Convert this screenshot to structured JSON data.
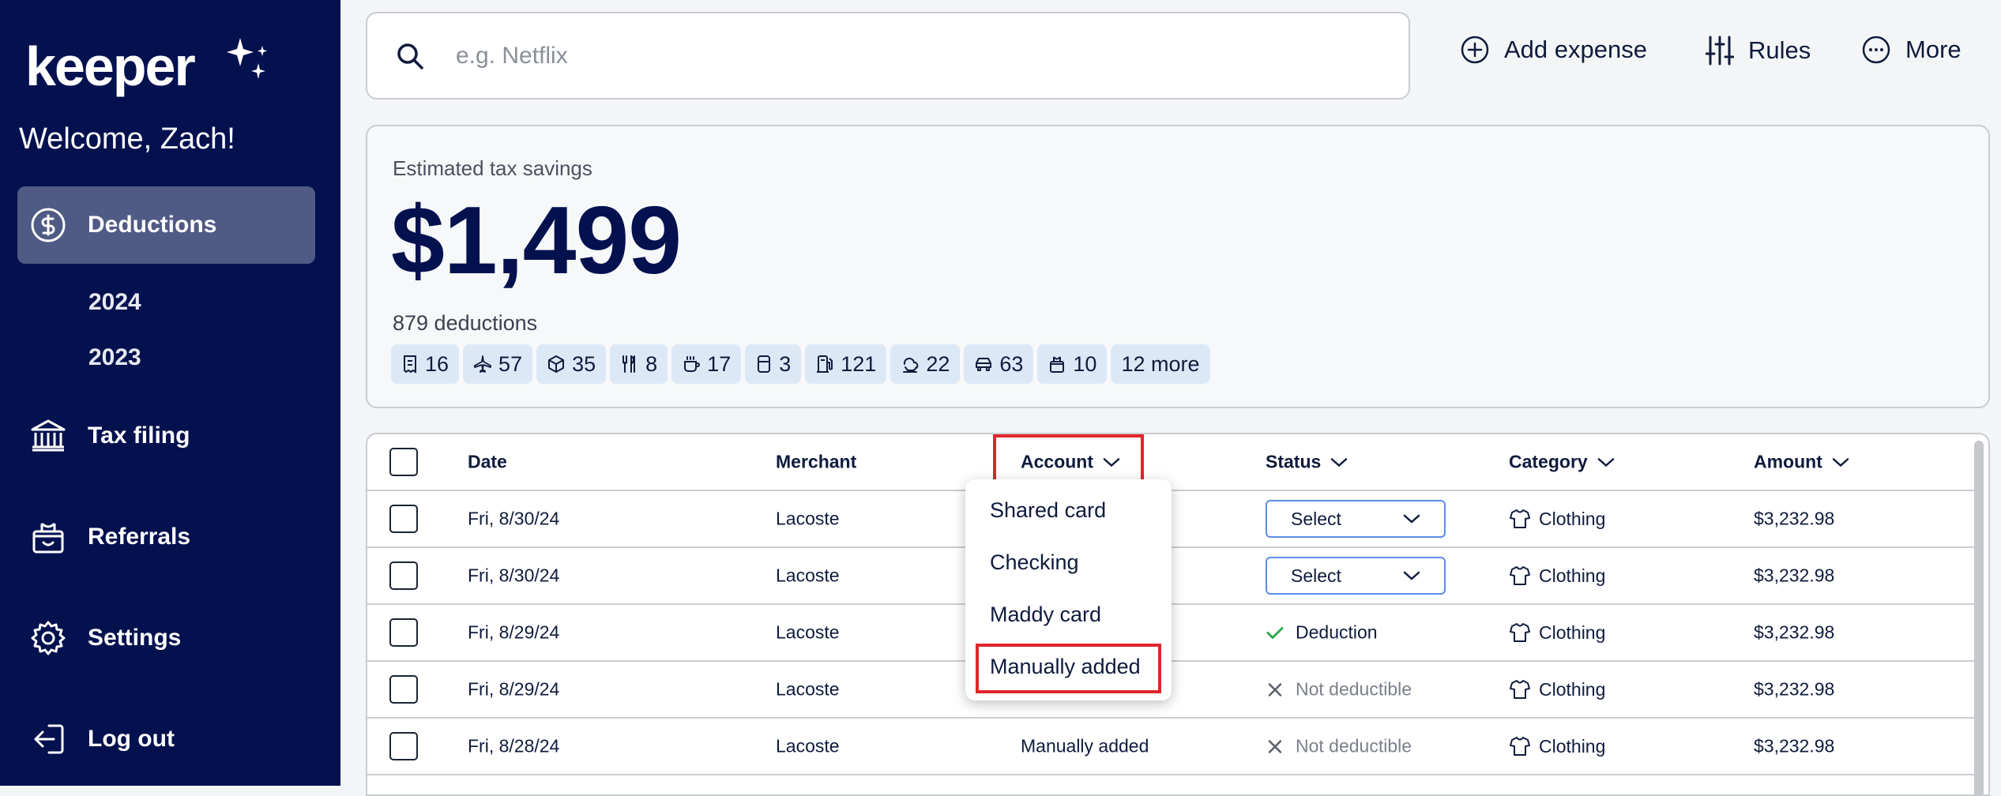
{
  "sidebar": {
    "brand": "keeper",
    "welcome": "Welcome, Zach!",
    "items": [
      {
        "label": "Deductions",
        "icon": "dollar-circle-icon",
        "active": true
      },
      {
        "label": "Tax filing",
        "icon": "bank-icon"
      },
      {
        "label": "Referrals",
        "icon": "gift-icon"
      },
      {
        "label": "Settings",
        "icon": "gear-icon"
      },
      {
        "label": "Log out",
        "icon": "logout-icon"
      }
    ],
    "years": [
      "2024",
      "2023"
    ]
  },
  "search": {
    "placeholder": "e.g. Netflix"
  },
  "toolbar": {
    "add_expense": "Add expense",
    "rules": "Rules",
    "more": "More"
  },
  "savings": {
    "label": "Estimated tax savings",
    "amount": "$1,499",
    "deductions_count": "879 deductions",
    "chips": [
      {
        "icon": "receipt-icon",
        "count": "16"
      },
      {
        "icon": "airplane-icon",
        "count": "57"
      },
      {
        "icon": "box-icon",
        "count": "35"
      },
      {
        "icon": "utensils-icon",
        "count": "8"
      },
      {
        "icon": "coffee-icon",
        "count": "17"
      },
      {
        "icon": "phone-icon",
        "count": "3"
      },
      {
        "icon": "fuel-icon",
        "count": "121"
      },
      {
        "icon": "cloud-car-icon",
        "count": "22"
      },
      {
        "icon": "car-icon",
        "count": "63"
      },
      {
        "icon": "basket-icon",
        "count": "10"
      }
    ],
    "more_chip": "12 more"
  },
  "table": {
    "headers": {
      "date": "Date",
      "merchant": "Merchant",
      "account": "Account",
      "status": "Status",
      "category": "Category",
      "amount": "Amount"
    },
    "rows": [
      {
        "date": "Fri, 8/30/24",
        "merchant": "Lacoste",
        "account": "",
        "status": "Select",
        "status_type": "select",
        "category": "Clothing",
        "amount": "$3,232.98"
      },
      {
        "date": "Fri, 8/30/24",
        "merchant": "Lacoste",
        "account": "",
        "status": "Select",
        "status_type": "select",
        "category": "Clothing",
        "amount": "$3,232.98"
      },
      {
        "date": "Fri, 8/29/24",
        "merchant": "Lacoste",
        "account": "",
        "status": "Deduction",
        "status_type": "deduction",
        "category": "Clothing",
        "amount": "$3,232.98"
      },
      {
        "date": "Fri, 8/29/24",
        "merchant": "Lacoste",
        "account": "",
        "status": "Not deductible",
        "status_type": "not",
        "category": "Clothing",
        "amount": "$3,232.98"
      },
      {
        "date": "Fri, 8/28/24",
        "merchant": "Lacoste",
        "account": "Manually added",
        "status": "Not deductible",
        "status_type": "not",
        "category": "Clothing",
        "amount": "$3,232.98"
      }
    ]
  },
  "account_dropdown": {
    "options": [
      "Shared card",
      "Checking",
      "Maddy card",
      "Manually added"
    ],
    "highlighted": "Manually added"
  },
  "colors": {
    "sidebar_bg": "#04114f",
    "active_nav": "#4f5b85",
    "chip_bg": "#dde8f7",
    "highlight": "#e0262b",
    "select_border": "#5b8de6",
    "check_green": "#2fa84f"
  }
}
